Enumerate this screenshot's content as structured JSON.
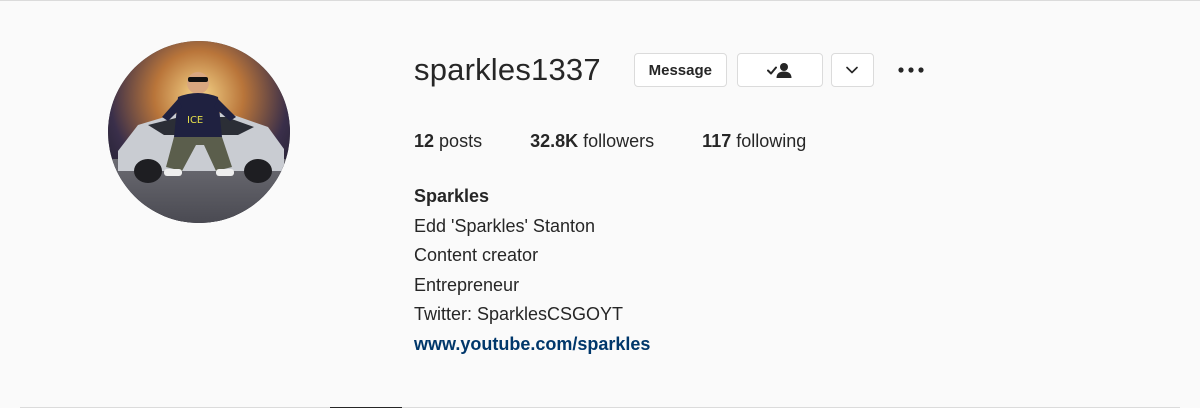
{
  "profile": {
    "username": "sparkles1337",
    "message_label": "Message",
    "following_icon": "person-check-icon",
    "dropdown_icon": "chevron-down-icon",
    "more_icon": "more-options-icon"
  },
  "stats": {
    "posts_count": "12",
    "posts_label": "posts",
    "followers_count": "32.8K",
    "followers_label": "followers",
    "following_count": "117",
    "following_label": "following"
  },
  "bio": {
    "name": "Sparkles",
    "lines": [
      "Edd 'Sparkles' Stanton",
      "Content creator",
      "Entrepreneur",
      "Twitter: SparklesCSGOYT"
    ],
    "link": "www.youtube.com/sparkles"
  },
  "colors": {
    "background": "#fafafa",
    "text": "#262626",
    "border": "#dbdbdb",
    "link": "#00376b"
  }
}
